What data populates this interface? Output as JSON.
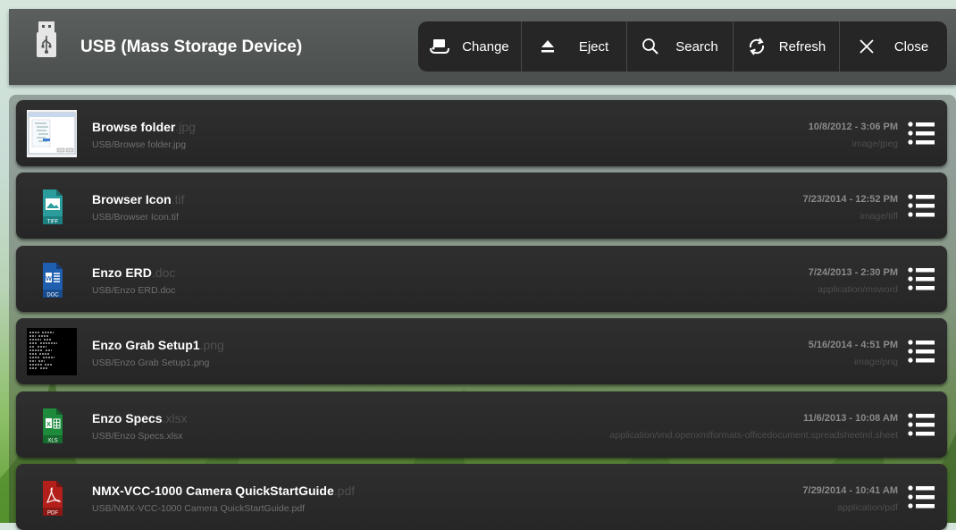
{
  "header": {
    "title": "USB (Mass Storage Device)",
    "device_icon": "usb-drive-icon"
  },
  "toolbar": [
    {
      "label": "Change",
      "icon": "storage-change-icon"
    },
    {
      "label": "Eject",
      "icon": "eject-icon"
    },
    {
      "label": "Search",
      "icon": "search-icon"
    },
    {
      "label": "Refresh",
      "icon": "refresh-icon"
    },
    {
      "label": "Close",
      "icon": "close-icon"
    }
  ],
  "files": [
    {
      "name": "Browse folder",
      "ext": ".jpg",
      "path": "USB/Browse folder.jpg",
      "date": "10/8/2012 - 3:06 PM",
      "mime": "image/jpeg",
      "thumb": "screenshot-thumbnail"
    },
    {
      "name": "Browser Icon",
      "ext": ".tif",
      "path": "USB/Browser Icon.tif",
      "date": "7/23/2014 - 12:52 PM",
      "mime": "image/tiff",
      "thumb": "tiff-file-icon",
      "thumb_label": "TIFF"
    },
    {
      "name": "Enzo ERD",
      "ext": ".doc",
      "path": "USB/Enzo ERD.doc",
      "date": "7/24/2013 - 2:30 PM",
      "mime": "application/msword",
      "thumb": "doc-file-icon",
      "thumb_label": "DOC"
    },
    {
      "name": "Enzo Grab Setup1",
      "ext": ".png",
      "path": "USB/Enzo Grab Setup1.png",
      "date": "5/16/2014 - 4:51 PM",
      "mime": "image/png",
      "thumb": "terminal-screenshot-thumbnail"
    },
    {
      "name": "Enzo Specs",
      "ext": ".xlsx",
      "path": "USB/Enzo Specs.xlsx",
      "date": "11/6/2013 - 10:08 AM",
      "mime": "application/vnd.openxmlformats-officedocument.spreadsheetml.sheet",
      "thumb": "xls-file-icon",
      "thumb_label": "XLS"
    },
    {
      "name": "NMX-VCC-1000 Camera QuickStartGuide",
      "ext": ".pdf",
      "path": "USB/NMX-VCC-1000 Camera QuickStartGuide.pdf",
      "date": "7/29/2014 - 10:41 AM",
      "mime": "application/pdf",
      "thumb": "pdf-file-icon",
      "thumb_label": "PDF"
    }
  ],
  "colors": {
    "header_bg": "#4f5351",
    "toolbar_bg": "#262626",
    "row_bg": "#2b2b2b",
    "tiff_icon": "#2a9c9c",
    "doc_icon": "#1f5fb0",
    "xls_icon": "#1e8a3c",
    "pdf_icon": "#b3201b"
  }
}
